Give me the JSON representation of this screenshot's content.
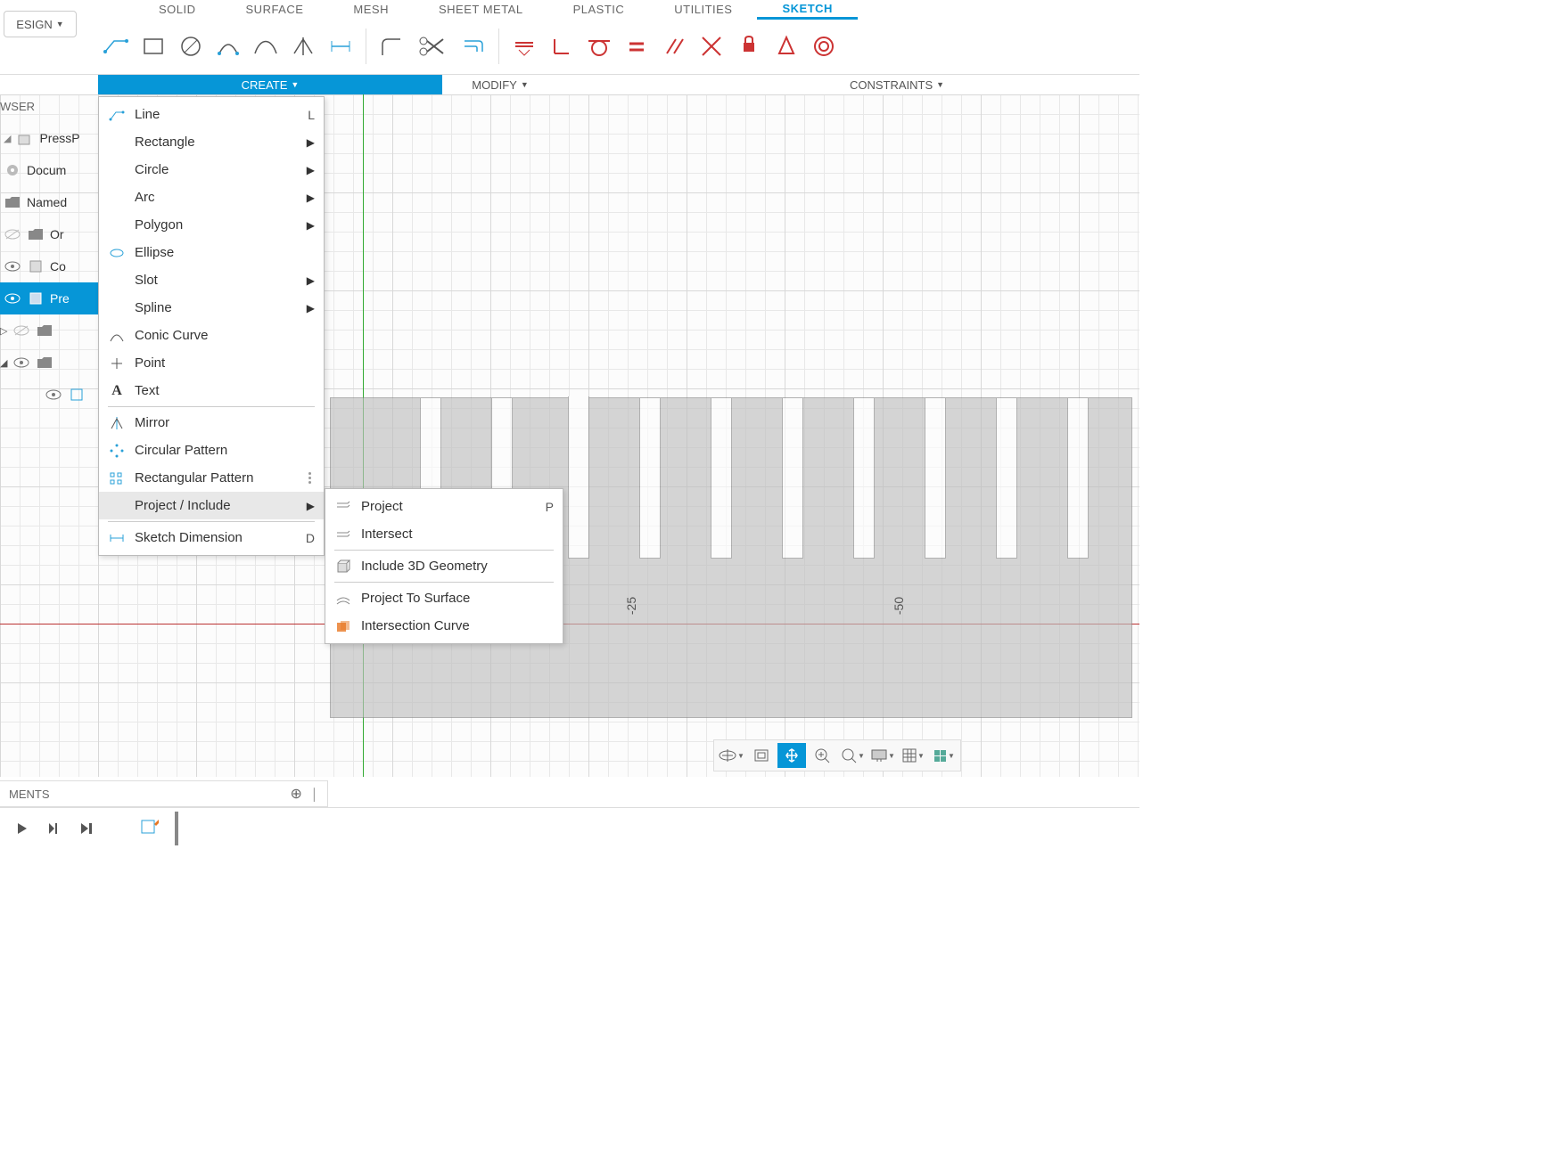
{
  "design_button": "ESIGN",
  "ribbon_tabs": [
    "SOLID",
    "SURFACE",
    "MESH",
    "SHEET METAL",
    "PLASTIC",
    "UTILITIES",
    "SKETCH"
  ],
  "active_tab": "SKETCH",
  "panels": {
    "create": "CREATE",
    "modify": "MODIFY",
    "constraints": "CONSTRAINTS"
  },
  "browser": {
    "title": "WSER",
    "items": [
      {
        "label": "PressP"
      },
      {
        "label": "Docum"
      },
      {
        "label": "Named"
      },
      {
        "label": "Or"
      },
      {
        "label": "Co"
      },
      {
        "label": "Pre",
        "selected": true
      }
    ]
  },
  "create_menu": [
    {
      "icon": "line",
      "label": "Line",
      "shortcut": "L"
    },
    {
      "label": "Rectangle",
      "submenu": true
    },
    {
      "label": "Circle",
      "submenu": true
    },
    {
      "label": "Arc",
      "submenu": true
    },
    {
      "label": "Polygon",
      "submenu": true
    },
    {
      "icon": "ellipse",
      "label": "Ellipse"
    },
    {
      "label": "Slot",
      "submenu": true
    },
    {
      "label": "Spline",
      "submenu": true
    },
    {
      "icon": "conic",
      "label": "Conic Curve"
    },
    {
      "icon": "point",
      "label": "Point"
    },
    {
      "icon": "text",
      "label": "Text"
    },
    {
      "sep": true
    },
    {
      "icon": "mirror",
      "label": "Mirror"
    },
    {
      "icon": "circpattern",
      "label": "Circular Pattern"
    },
    {
      "icon": "rectpattern",
      "label": "Rectangular Pattern",
      "dots": true
    },
    {
      "label": "Project / Include",
      "submenu": true,
      "highlight": true
    },
    {
      "sep": true
    },
    {
      "icon": "dimension",
      "label": "Sketch Dimension",
      "shortcut": "D"
    }
  ],
  "project_menu": [
    {
      "icon": "project",
      "label": "Project",
      "shortcut": "P"
    },
    {
      "icon": "intersect",
      "label": "Intersect"
    },
    {
      "sep": true
    },
    {
      "icon": "include3d",
      "label": "Include 3D Geometry"
    },
    {
      "sep": true
    },
    {
      "icon": "projsurface",
      "label": "Project To Surface"
    },
    {
      "icon": "intercurve",
      "label": "Intersection Curve"
    }
  ],
  "axis_labels": {
    "a": "-25",
    "b": "-50"
  },
  "comments": "MENTS",
  "nav_tools": [
    "orbit",
    "lookat",
    "pan",
    "zoomfit",
    "zoom",
    "display",
    "grid",
    "viewcube"
  ]
}
